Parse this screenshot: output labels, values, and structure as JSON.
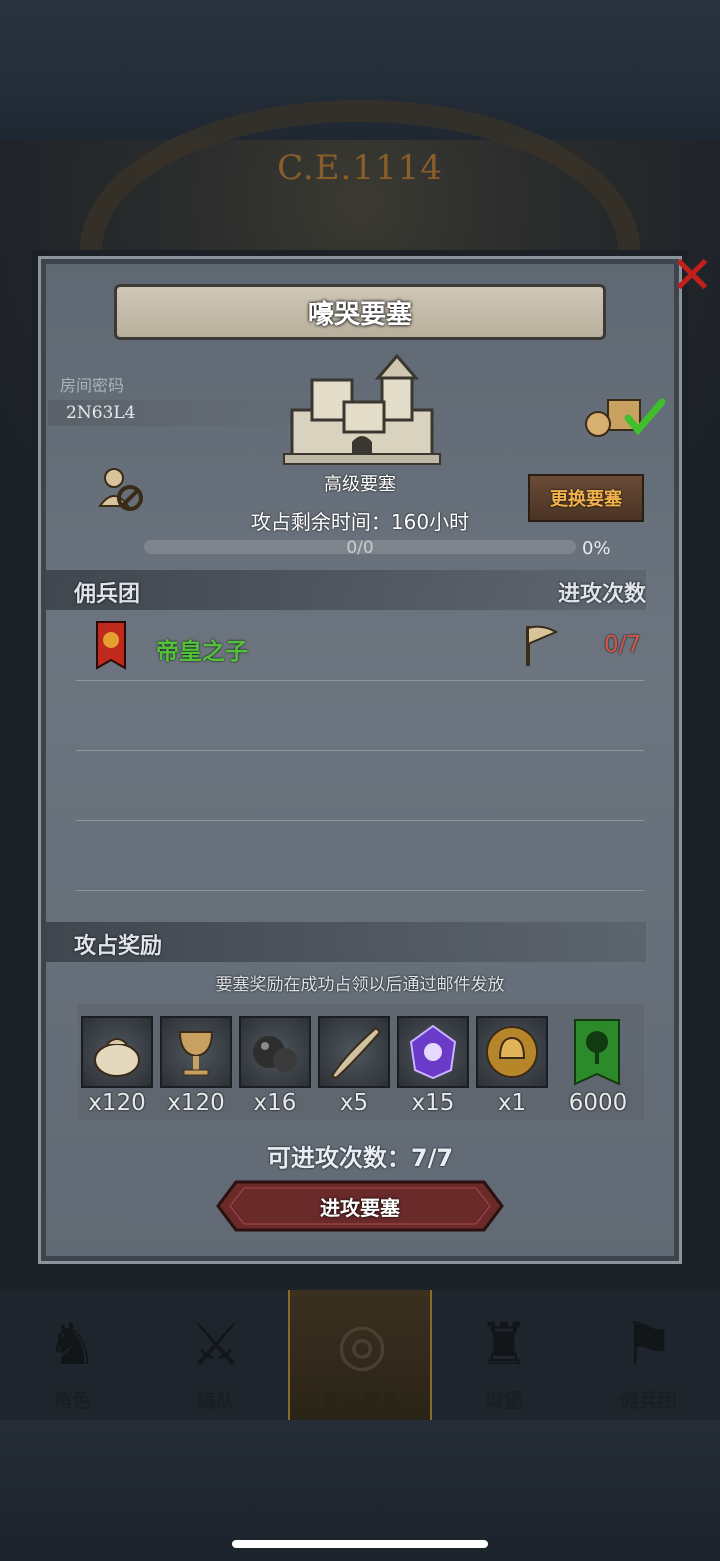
{
  "era": "C.E.1114",
  "title": "嚎哭要塞",
  "room": {
    "label": "房间密码",
    "code": "2N63L4"
  },
  "fortress": {
    "type": "高级要塞",
    "change_label": "更换要塞",
    "time_text": "攻占剩余时间：160小时"
  },
  "progress": {
    "text": "0/0",
    "percent_text": "0%",
    "fraction": 0
  },
  "mercenary": {
    "header": "佣兵团",
    "attempts_header": "进攻次数",
    "rows": [
      {
        "name": "帝皇之子",
        "attempts": "0/7"
      }
    ]
  },
  "rewards": {
    "header": "攻占奖励",
    "note": "要塞奖励在成功占领以后通过邮件发放",
    "items": [
      {
        "icon": "sack-icon",
        "count": "x120"
      },
      {
        "icon": "goblet-icon",
        "count": "x120"
      },
      {
        "icon": "ore-icon",
        "count": "x16"
      },
      {
        "icon": "horn-icon",
        "count": "x5"
      },
      {
        "icon": "crystal-icon",
        "count": "x15"
      },
      {
        "icon": "helmet-medal-icon",
        "count": "x1"
      },
      {
        "icon": "tree-banner-icon",
        "count": "6000"
      }
    ]
  },
  "remaining_attacks": "可进攻次数：7/7",
  "attack_button": "进攻要塞",
  "nav": [
    {
      "label": "角色",
      "icon": "character-icon"
    },
    {
      "label": "编队",
      "icon": "formation-icon"
    },
    {
      "label": "前往群岛",
      "icon": "islands-icon",
      "active": true
    },
    {
      "label": "城堡",
      "icon": "castle-icon"
    },
    {
      "label": "佣兵团",
      "icon": "mercenary-icon"
    }
  ],
  "colors": {
    "accent_green": "#52c23a",
    "attempts_red": "#d8534a",
    "close_red": "#c1201a",
    "button_gold": "#f2b24c"
  }
}
